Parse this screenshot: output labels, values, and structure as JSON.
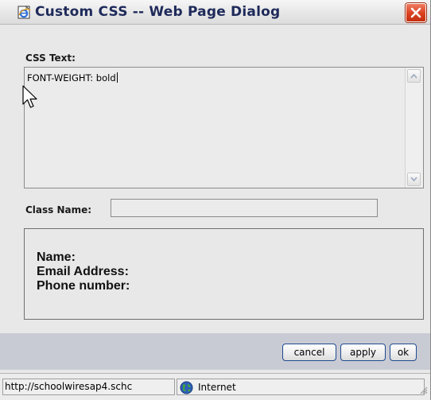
{
  "window": {
    "title": "Custom CSS -- Web Page Dialog",
    "title_icon": "ie-page-icon",
    "close_icon": "close-icon",
    "close_color": "#d9411e"
  },
  "css_section": {
    "label": "CSS Text:",
    "value": "FONT-WEIGHT: bold"
  },
  "class_section": {
    "label": "Class Name:",
    "value": ""
  },
  "preview": {
    "lines": [
      "Name:",
      "Email Address:",
      "Phone number:"
    ]
  },
  "buttons": {
    "cancel": "cancel",
    "apply": "apply",
    "ok": "ok"
  },
  "statusbar": {
    "url": "http://schoolwiresap4.schc",
    "zone": "Internet",
    "zone_icon": "globe-icon"
  }
}
